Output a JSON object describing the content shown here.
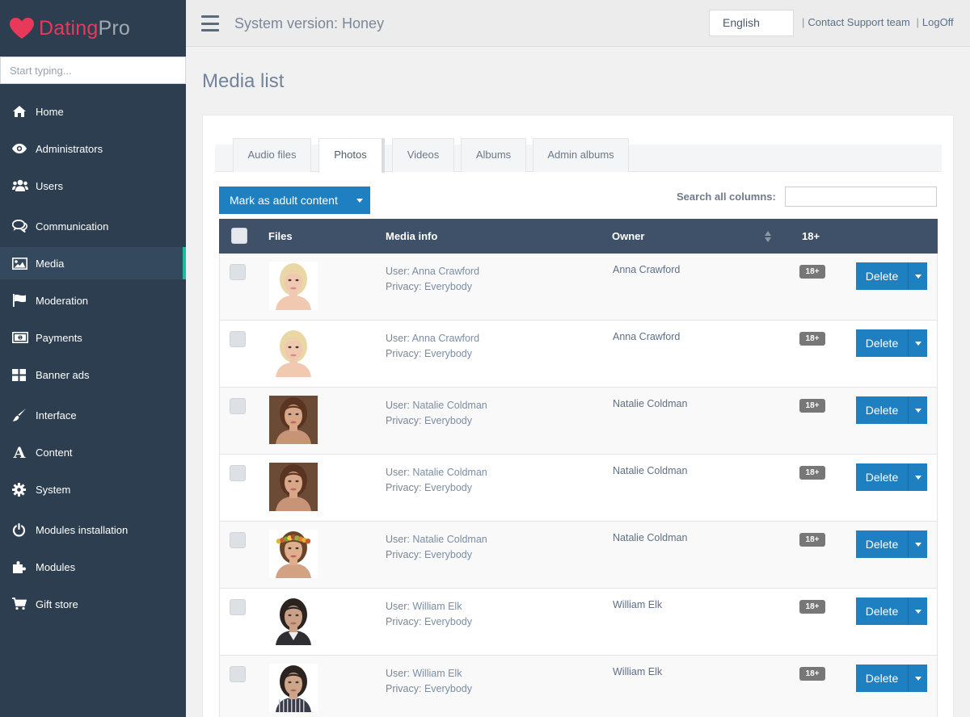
{
  "brand": {
    "name_main": "Dating",
    "name_suffix": "Pro",
    "accent": "#e8395a"
  },
  "sidebar": {
    "search_placeholder": "Start typing...",
    "items": [
      {
        "label": "Home",
        "icon": "home-icon"
      },
      {
        "label": "Administrators",
        "icon": "eye-icon"
      },
      {
        "label": "Users",
        "icon": "users-icon"
      },
      {
        "label": "Communication",
        "icon": "comments-icon"
      },
      {
        "label": "Media",
        "icon": "image-icon",
        "active": true
      },
      {
        "label": "Moderation",
        "icon": "flag-icon"
      },
      {
        "label": "Payments",
        "icon": "money-icon"
      },
      {
        "label": "Banner ads",
        "icon": "grid-icon"
      },
      {
        "label": "Interface",
        "icon": "brush-icon"
      },
      {
        "label": "Content",
        "icon": "font-icon"
      },
      {
        "label": "System",
        "icon": "gear-icon"
      },
      {
        "label": "Modules installation",
        "icon": "power-icon"
      },
      {
        "label": "Modules",
        "icon": "puzzle-icon"
      },
      {
        "label": "Gift store",
        "icon": "cart-icon"
      }
    ]
  },
  "header": {
    "system_version": "System version: Honey",
    "language": "English",
    "separator": "|",
    "support_link": "Contact Support team",
    "logoff_link": "LogOff"
  },
  "page_title": "Media list",
  "tabs": [
    {
      "label": "Audio files"
    },
    {
      "label": "Photos",
      "active": true
    },
    {
      "label": "Videos"
    },
    {
      "label": "Albums"
    },
    {
      "label": "Admin albums"
    }
  ],
  "toolbar": {
    "mark_adult_label": "Mark as adult content",
    "search_label": "Search all columns:",
    "search_value": ""
  },
  "table": {
    "columns": {
      "files": "Files",
      "media_info": "Media info",
      "owner": "Owner",
      "adult": "18+"
    },
    "user_prefix": "User: ",
    "privacy_prefix": "Privacy: ",
    "delete_label": "Delete",
    "badge_label": "18+",
    "rows": [
      {
        "user": "Anna Crawford",
        "privacy": "Everybody",
        "owner": "Anna Crawford",
        "photo": "blonde-woman"
      },
      {
        "user": "Anna Crawford",
        "privacy": "Everybody",
        "owner": "Anna Crawford",
        "photo": "blonde-woman"
      },
      {
        "user": "Natalie Coldman",
        "privacy": "Everybody",
        "owner": "Natalie Coldman",
        "photo": "brunette-woman"
      },
      {
        "user": "Natalie Coldman",
        "privacy": "Everybody",
        "owner": "Natalie Coldman",
        "photo": "brunette-woman"
      },
      {
        "user": "Natalie Coldman",
        "privacy": "Everybody",
        "owner": "Natalie Coldman",
        "photo": "woman-flower-wreath"
      },
      {
        "user": "William Elk",
        "privacy": "Everybody",
        "owner": "William Elk",
        "photo": "man-dark-jacket"
      },
      {
        "user": "William Elk",
        "privacy": "Everybody",
        "owner": "William Elk",
        "photo": "man-striped-shirt"
      }
    ]
  }
}
